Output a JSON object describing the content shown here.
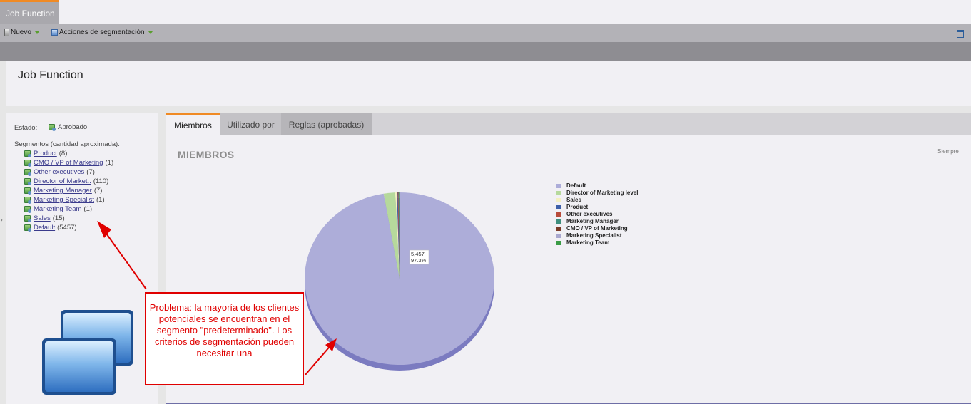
{
  "window": {
    "tab_label": "Job Function"
  },
  "toolbar": {
    "new_label": "Nuevo",
    "segmentation_actions_label": "Acciones de segmentación"
  },
  "header": {
    "title": "Job Function"
  },
  "left_panel": {
    "status_label": "Estado:",
    "status_value": "Aprobado",
    "segments_label": "Segmentos (cantidad aproximada):",
    "segments": [
      {
        "name": "Product",
        "count": "(8)"
      },
      {
        "name": "CMO / VP of Marketing",
        "count": "(1)"
      },
      {
        "name": "Other executives",
        "count": "(7)"
      },
      {
        "name": "Director of Market..",
        "count": "(110)"
      },
      {
        "name": "Marketing Manager",
        "count": "(7)"
      },
      {
        "name": "Marketing Specialist",
        "count": "(1)"
      },
      {
        "name": "Marketing Team",
        "count": "(1)"
      },
      {
        "name": "Sales",
        "count": "(15)"
      },
      {
        "name": "Default",
        "count": "(5457)"
      }
    ]
  },
  "main": {
    "tabs": [
      {
        "label": "Miembros",
        "active": true
      },
      {
        "label": "Utilizado por",
        "active": false
      },
      {
        "label": "Reglas (aprobadas)",
        "active": false
      }
    ],
    "section_title": "MIEMBROS",
    "period_label": "Siempre"
  },
  "chart_data": {
    "type": "pie",
    "title": "",
    "slice_label": {
      "value": "5,457",
      "percent": "97.3%"
    },
    "series": [
      {
        "name": "Default",
        "value": 5457,
        "color": "#adadd9"
      },
      {
        "name": "Director of Marketing level",
        "value": 110,
        "color": "#b6d99c"
      },
      {
        "name": "Sales",
        "value": 15,
        "color": "#f4f0c0"
      },
      {
        "name": "Product",
        "value": 8,
        "color": "#3d5fa8"
      },
      {
        "name": "Other executives",
        "value": 7,
        "color": "#b84b3a"
      },
      {
        "name": "Marketing Manager",
        "value": 7,
        "color": "#3f8f7e"
      },
      {
        "name": "CMO / VP of Marketing",
        "value": 1,
        "color": "#7a3a26"
      },
      {
        "name": "Marketing Specialist",
        "value": 1,
        "color": "#a9a8cf"
      },
      {
        "name": "Marketing Team",
        "value": 1,
        "color": "#3a9b45"
      }
    ],
    "side_color": "#7b7bc0",
    "legend_position": "right"
  },
  "annotation": {
    "text": "Problema: la mayoría de los clientes potenciales se encuentran en el segmento \"predeterminado\". Los criterios de segmentación pueden necesitar una",
    "color": "#e00000"
  }
}
